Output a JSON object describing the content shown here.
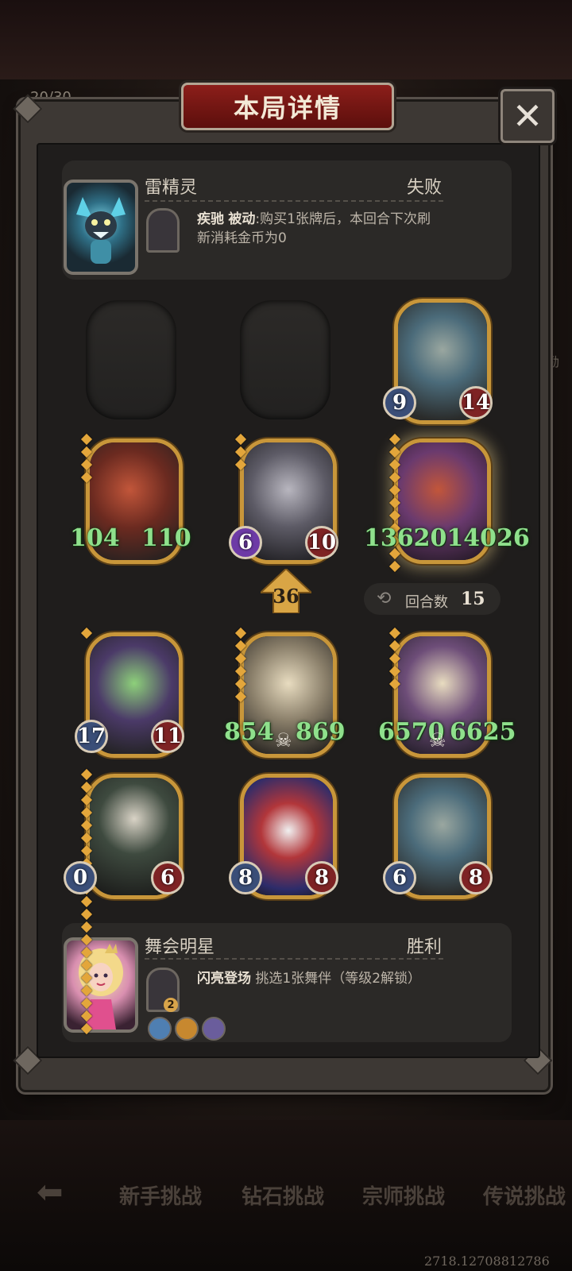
{
  "background": {
    "counter_text": "20/30",
    "right_edge_text": "励",
    "bottom_tabs": [
      "新手挑战",
      "钻石挑战",
      "宗师挑战",
      "传说挑战"
    ],
    "version_text": "2718.12708812786"
  },
  "dialog": {
    "title": "本局详情",
    "close_label": "✕"
  },
  "opponent": {
    "name": "雷精灵",
    "result": "失败",
    "skill_name": "疾驰",
    "skill_type": "被动",
    "skill_desc": ":购买1张牌后，本回合下次刷新消耗金币为0"
  },
  "player": {
    "name": "舞会明星",
    "result": "胜利",
    "skill_name": "闪亮登场",
    "skill_desc": "挑选1张舞伴（等级2解锁）",
    "skill_level_badge": "2"
  },
  "board": {
    "level": "36",
    "round_label": "回合数",
    "round_value": "15",
    "units": [
      {
        "row": 0,
        "col": 2,
        "atk": "9",
        "hp": "14",
        "pips": 0,
        "art": "blue-dragon"
      },
      {
        "row": 1,
        "col": 0,
        "atk": "104",
        "hp": "110",
        "pips": 4,
        "art": "red-serpent",
        "big": true
      },
      {
        "row": 1,
        "col": 1,
        "atk": "6",
        "hp": "10",
        "pips": 3,
        "art": "grey-dragon",
        "atk_style": "purple"
      },
      {
        "row": 1,
        "col": 2,
        "atk": "136201",
        "hp": "4026",
        "pips": 11,
        "art": "red-serpent-purple",
        "big": true,
        "combined": "1362014026",
        "glow": true
      },
      {
        "row": 2,
        "col": 0,
        "atk": "17",
        "hp": "11",
        "pips": 1,
        "art": "green-drake"
      },
      {
        "row": 2,
        "col": 1,
        "atk": "854",
        "hp": "869",
        "pips": 6,
        "art": "bone-dragon",
        "big": true,
        "skull": true
      },
      {
        "row": 2,
        "col": 2,
        "atk": "6570",
        "hp": "6625",
        "pips": 5,
        "art": "bone-dragon-purple",
        "big": true,
        "skull": true
      },
      {
        "row": 3,
        "col": 0,
        "atk": "0",
        "hp": "6",
        "pips": 21,
        "art": "cloaked-reaper",
        "cut_left": true
      },
      {
        "row": 3,
        "col": 1,
        "atk": "8",
        "hp": "8",
        "pips": 0,
        "art": "jester"
      },
      {
        "row": 3,
        "col": 2,
        "atk": "6",
        "hp": "8",
        "pips": 0,
        "art": "blue-dragon"
      }
    ],
    "empty_slots": 2
  },
  "colors": {
    "gold_frame": "#c8963a",
    "big_number_green": "#8fe08c",
    "title_red": "#8c1e1a"
  }
}
